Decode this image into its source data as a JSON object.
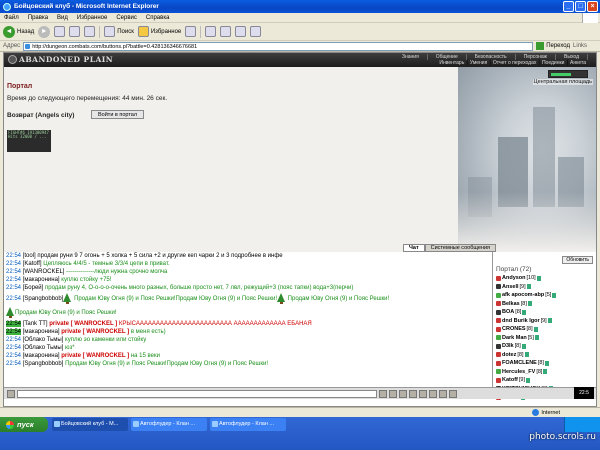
{
  "window": {
    "title": "Бойцовский клуб - Microsoft Internet Explorer"
  },
  "menu": [
    "Файл",
    "Правка",
    "Вид",
    "Избранное",
    "Сервис",
    "Справка"
  ],
  "toolbar": {
    "back": "Назад",
    "search": "Поиск",
    "favorites": "Избранное"
  },
  "address": {
    "label": "Адрес",
    "url": "http://dungeon.combats.com/buttons.pl?battle=0.428136346676681",
    "go": "Переход",
    "links": "Links"
  },
  "game": {
    "logo": "ABANDONED PLAIN",
    "nav_top": [
      "Знания",
      "Общение",
      "Безопасность",
      "Персонаж",
      "Выход"
    ],
    "nav_bottom": [
      "Инвентарь",
      "Умения",
      "Отчет о переходах",
      "Поединки",
      "Анкета"
    ],
    "location": "Центральная площадь",
    "portal_title": "Портал",
    "portal_timer": "Время до следующего перемещения: 44 мин. 26 сек.",
    "return_label": "Возврат (Angels city)",
    "enter_button": "Войти в портал",
    "counter_lines": [
      "FIGHT#6 191300947",
      "Hits 32000 / ..."
    ]
  },
  "chat": {
    "tabs": [
      "Чат",
      "Системные сообщения"
    ],
    "messages": [
      {
        "time": "22:54",
        "name": "[tool]",
        "text": " продам руни 9 7 огонь + 5 холка + 5 сила +2 и другие кеп чарки 2 и 3 подробнее в инфе",
        "style": "x"
      },
      {
        "time": "22:54",
        "name": "[Katoff]",
        "text": " Цепляюсь 4/4/5 - темные 3/3/4 цепи в приват.",
        "style": "g"
      },
      {
        "time": "22:54",
        "name": "[WANROCKEL]",
        "text": " --------------люди нужна срочно молча",
        "style": "g"
      },
      {
        "time": "22:54",
        "name": "[макаронина]",
        "text": " куплю стойку +75!",
        "style": "g"
      },
      {
        "time": "22:54",
        "name": "[Борей]",
        "text": " продам руну 4, О-о-о-о-очень много разных, больше просто нет, 7 лвл, режущий+3 (пояс тапки) вода+3(перчи)",
        "style": "g"
      },
      {
        "time": "22:54",
        "name": "[Spangbobbob]",
        "text": " Продам Юву Огня (9) и Пояс Решки!Продам Юву Огня (9) и Пояс Решки!",
        "text2": " Продам Юву Огня (9) и Пояс Решки!",
        "style": "g",
        "tall": true
      },
      {
        "time": "",
        "name": "",
        "text": "Продам Юву Огня (9) и Пояс Решки!",
        "style": "g",
        "tall": true
      },
      {
        "time": "22:54",
        "name": "[Tank TT]",
        "priv": "private [ WANROCKEL ]",
        "text": " КРЫСАААААААААААААААААААААААА ААААААААААААА ЕБАНАЯ",
        "style": "red",
        "hl": true
      },
      {
        "time": "22:54",
        "name": "[макаронина]",
        "priv": "private [ WANROCKEL ]",
        "text": " в меня есть)",
        "style": "g",
        "hl": true
      },
      {
        "time": "22:54",
        "name": "[Облако Тьмы]",
        "text": " куплю эо каменки или стойку",
        "style": "g"
      },
      {
        "time": "22:54",
        "name": "[Облако Тьмы]",
        "text": " юз*",
        "style": "g"
      },
      {
        "time": "22:54",
        "name": "[макаронина]",
        "priv": "private [ WANROCKEL ]",
        "text": " на 15 веки",
        "style": "g"
      },
      {
        "time": "22:54",
        "name": "[Spangbobbob]",
        "text": " Продам Юву Огня (9) и Пояс Решки!Продам Юву Огня (9) и Пояс Решки!",
        "style": "g"
      }
    ],
    "clock": "22:5"
  },
  "online": {
    "refresh": "Обновить",
    "title": "Портал (72)",
    "users": [
      {
        "name": "Andyson",
        "lvl": "[10]"
      },
      {
        "name": "Ansell",
        "lvl": "[9]"
      },
      {
        "name": "afk apocom-abp",
        "lvl": "[5]"
      },
      {
        "name": "Belkas",
        "lvl": "[8]"
      },
      {
        "name": "BOA",
        "lvl": "[8]"
      },
      {
        "name": "dnd Burik Igor",
        "lvl": "[9]"
      },
      {
        "name": "CRONES",
        "lvl": "[8]"
      },
      {
        "name": "Dark Man",
        "lvl": "[5]"
      },
      {
        "name": "D3lk",
        "lvl": "[8]"
      },
      {
        "name": "dotez",
        "lvl": "[8]"
      },
      {
        "name": "FOAMCLENE",
        "lvl": "[8]"
      },
      {
        "name": "Hercules_FV",
        "lvl": "[8]"
      },
      {
        "name": "Katoff",
        "lvl": "[9]"
      },
      {
        "name": "KRITOVICHOK",
        "lvl": "[8]"
      },
      {
        "name": "kzyt",
        "lvl": "[9]"
      }
    ]
  },
  "status": {
    "zone": "Internet"
  },
  "taskbar": {
    "start": "пуск",
    "tasks": [
      "Бойцовский клуб - M...",
      "Автофлудер - Клан ...",
      "Автофлудер - Клан ..."
    ],
    "watermark": "photo.scrols.ru"
  }
}
